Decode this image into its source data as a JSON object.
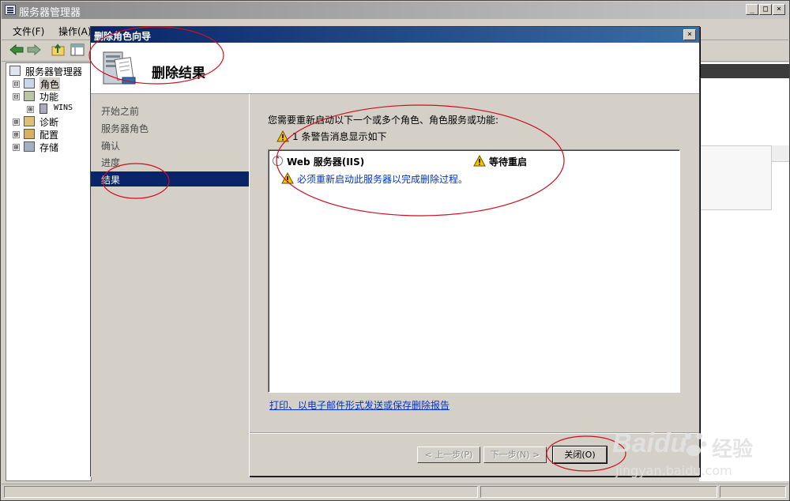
{
  "main": {
    "title": "服务器管理器",
    "menus": [
      "文件(F)",
      "操作(A)"
    ],
    "caption_buttons": {
      "minimize": "_",
      "restore": "□",
      "close": "×"
    }
  },
  "tree": {
    "root": "服务器管理器",
    "items": [
      {
        "label": "角色",
        "expander": "⊟"
      },
      {
        "label": "功能",
        "expander": "⊟"
      },
      {
        "label": "WINS",
        "expander": "⊞"
      },
      {
        "label": "诊断",
        "expander": "⊞"
      },
      {
        "label": "配置",
        "expander": "⊞"
      },
      {
        "label": "存储",
        "expander": "⊞"
      }
    ]
  },
  "dialog": {
    "title": "删除角色向导",
    "close_glyph": "×",
    "heading": "删除结果",
    "steps": [
      "开始之前",
      "服务器角色",
      "确认",
      "进度",
      "结果"
    ],
    "active_step": "结果",
    "intro": "您需要重新启动以下一个或多个角色、角色服务或功能:",
    "warning_summary": "1 条警告消息显示如下",
    "results": {
      "collapse_glyph": "⌃",
      "role_name": "Web 服务器(IIS)",
      "status": "等待重启",
      "message": "必须重新启动此服务器以完成删除过程。"
    },
    "report_link": "打印、以电子邮件形式发送或保存删除报告",
    "buttons": {
      "prev": "< 上一步(P)",
      "next": "下一步(N) >",
      "close": "关闭(O)"
    }
  },
  "watermark": {
    "brand": "Baidu",
    "sub": "经验",
    "url": "jingyan.baidu.com"
  },
  "colors": {
    "title_active": "#0a246a",
    "link": "#0033cc",
    "annotation": "#cc1020",
    "warning": "#f5c400"
  }
}
